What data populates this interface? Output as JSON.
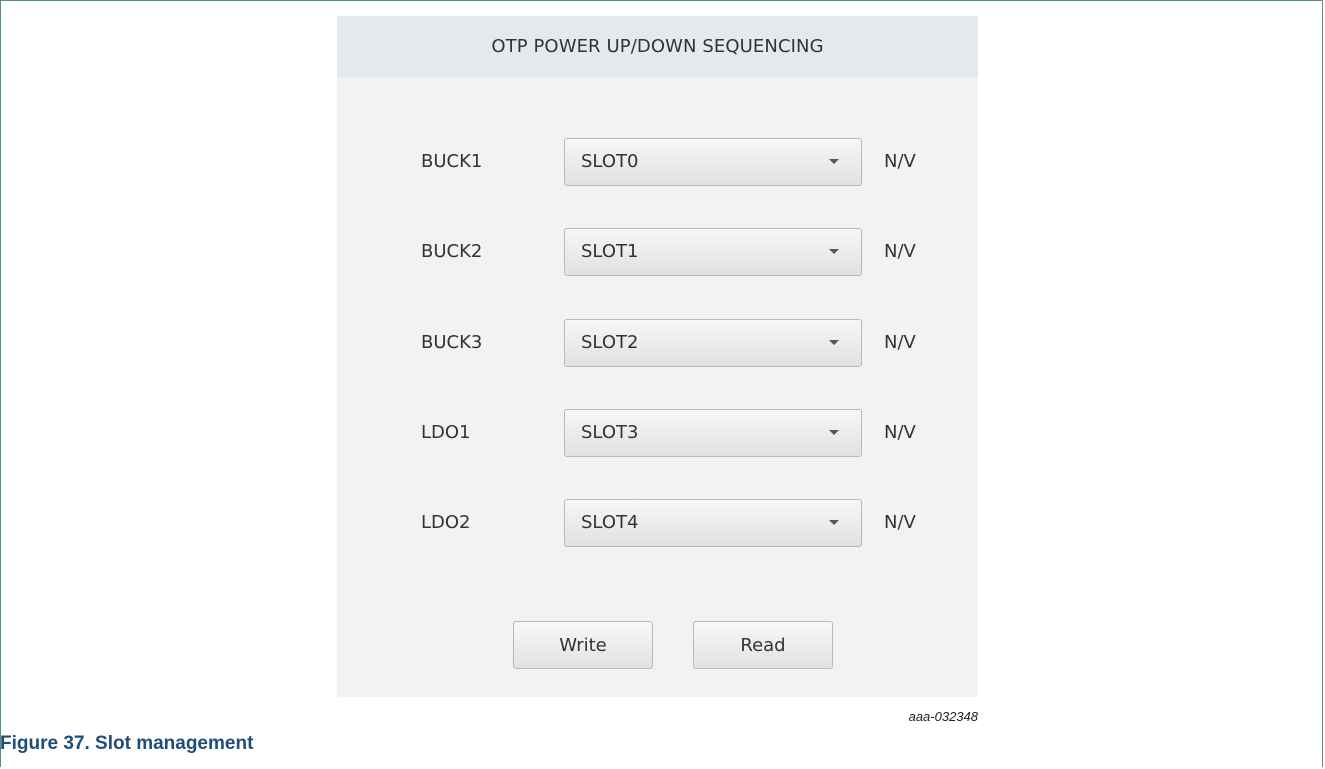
{
  "panel": {
    "title": "OTP POWER UP/DOWN SEQUENCING",
    "rows": [
      {
        "label": "BUCK1",
        "slot": "SLOT0",
        "status": "N/V"
      },
      {
        "label": "BUCK2",
        "slot": "SLOT1",
        "status": "N/V"
      },
      {
        "label": "BUCK3",
        "slot": "SLOT2",
        "status": "N/V"
      },
      {
        "label": "LDO1",
        "slot": "SLOT3",
        "status": "N/V"
      },
      {
        "label": "LDO2",
        "slot": "SLOT4",
        "status": "N/V"
      }
    ],
    "buttons": {
      "write_label": "Write",
      "read_label": "Read"
    }
  },
  "figure": {
    "image_id": "aaa-032348",
    "caption": "Figure 37.  Slot management"
  },
  "colors": {
    "frame_border": "#5c8f72",
    "caption_text": "#1f4e79",
    "panel_background": "#f2f2f2",
    "header_background": "#e6e9ec"
  },
  "icons": {
    "dropdown": "chevron-down-icon"
  }
}
